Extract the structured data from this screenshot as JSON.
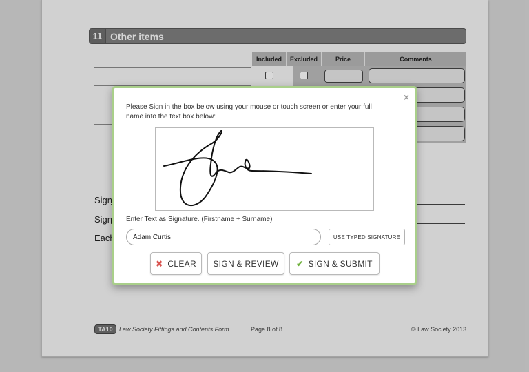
{
  "document": {
    "section": {
      "number": "11",
      "title": "Other items"
    },
    "columns": [
      "Included",
      "Excluded",
      "Price",
      "Comments"
    ],
    "labels": {
      "sign1": "Signe",
      "sign2": "Signe",
      "each": "Each"
    },
    "footer": {
      "badge": "TA10",
      "form_name": "Law Society Fittings and Contents Form",
      "page": "Page 8 of 8",
      "copyright": "© Law Society 2013"
    }
  },
  "modal": {
    "close_icon": "×",
    "instructions": "Please Sign in the box below using your mouse or touch screen or enter your full name into the text box below:",
    "text_label": "Enter Text as Signature. (Firstname + Surname)",
    "name_value": "Adam Curtis",
    "use_typed_label": "USE TYPED SIGNATURE",
    "buttons": {
      "clear": {
        "icon": "✖",
        "label": "CLEAR"
      },
      "review": {
        "label": "SIGN & REVIEW"
      },
      "submit": {
        "icon": "✔",
        "label": "SIGN & SUBMIT"
      }
    }
  },
  "colors": {
    "modal_border": "#a9cf8a",
    "clear_icon": "#d9534f",
    "submit_icon": "#6fb13d"
  }
}
